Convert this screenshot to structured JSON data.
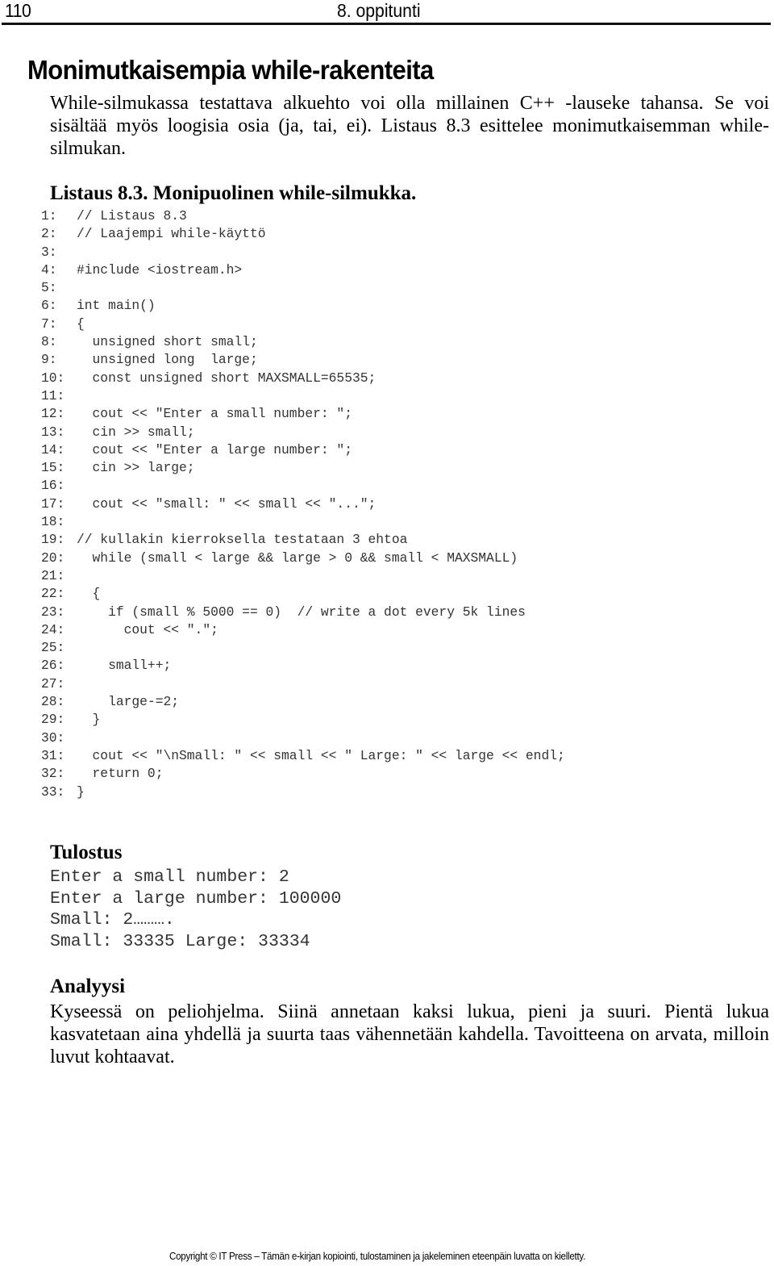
{
  "header": {
    "page_number": "110",
    "chapter": "8. oppitunti"
  },
  "title": "Monimutkaisempia while-rakenteita",
  "intro": "While-silmukassa testattava alkuehto voi olla millainen C++ -lauseke tahansa. Se voi sisältää myös loogisia osia (ja, tai, ei). Listaus 8.3 esittelee monimutkaisemman while-silmukan.",
  "listing": {
    "title": "Listaus 8.3. Monipuolinen while-silmukka.",
    "lines": [
      {
        "num": "1:",
        "code": "// Listaus 8.3"
      },
      {
        "num": "2:",
        "code": "// Laajempi while-käyttö"
      },
      {
        "num": "3:",
        "code": ""
      },
      {
        "num": "4:",
        "code": "#include <iostream.h>"
      },
      {
        "num": "5:",
        "code": ""
      },
      {
        "num": "6:",
        "code": "int main()"
      },
      {
        "num": "7:",
        "code": "{"
      },
      {
        "num": "8:",
        "code": "  unsigned short small;"
      },
      {
        "num": "9:",
        "code": "  unsigned long  large;"
      },
      {
        "num": "10:",
        "code": "  const unsigned short MAXSMALL=65535;"
      },
      {
        "num": "11:",
        "code": ""
      },
      {
        "num": "12:",
        "code": "  cout << \"Enter a small number: \";"
      },
      {
        "num": "13:",
        "code": "  cin >> small;"
      },
      {
        "num": "14:",
        "code": "  cout << \"Enter a large number: \";"
      },
      {
        "num": "15:",
        "code": "  cin >> large;"
      },
      {
        "num": "16:",
        "code": ""
      },
      {
        "num": "17:",
        "code": "  cout << \"small: \" << small << \"...\";"
      },
      {
        "num": "18:",
        "code": ""
      },
      {
        "num": "19:",
        "code": "// kullakin kierroksella testataan 3 ehtoa"
      },
      {
        "num": "20:",
        "code": "  while (small < large && large > 0 && small < MAXSMALL)"
      },
      {
        "num": "21:",
        "code": ""
      },
      {
        "num": "22:",
        "code": "  {"
      },
      {
        "num": "23:",
        "code": "    if (small % 5000 == 0)  // write a dot every 5k lines"
      },
      {
        "num": "24:",
        "code": "      cout << \".\";"
      },
      {
        "num": "25:",
        "code": ""
      },
      {
        "num": "26:",
        "code": "    small++;"
      },
      {
        "num": "27:",
        "code": ""
      },
      {
        "num": "28:",
        "code": "    large-=2;"
      },
      {
        "num": "29:",
        "code": "  }"
      },
      {
        "num": "30:",
        "code": ""
      },
      {
        "num": "31:",
        "code": "  cout << \"\\nSmall: \" << small << \" Large: \" << large << endl;"
      },
      {
        "num": "32:",
        "code": "  return 0;"
      },
      {
        "num": "33:",
        "code": "}"
      }
    ]
  },
  "output": {
    "title": "Tulostus",
    "lines": [
      "Enter a small number: 2",
      "Enter a large number: 100000",
      "Small: 2……….",
      "Small: 33335 Large: 33334"
    ]
  },
  "analysis": {
    "title": "Analyysi",
    "text": "Kyseessä on peliohjelma. Siinä annetaan kaksi lukua, pieni ja suuri. Pientä lukua kasvatetaan aina yhdellä ja suurta taas vähennetään kahdella. Tavoitteena on arvata, milloin luvut kohtaavat."
  },
  "footer": "Copyright © IT Press – Tämän e-kirjan kopiointi, tulostaminen ja jakeleminen eteenpäin luvatta on kielletty."
}
